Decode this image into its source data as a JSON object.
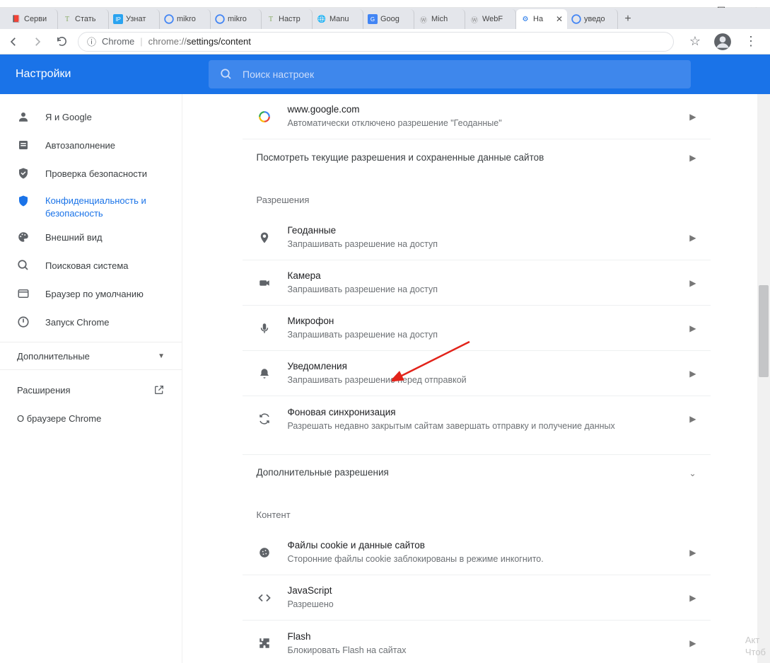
{
  "window": {
    "min": "—",
    "max": "☐",
    "close": "✕"
  },
  "tabs": [
    {
      "label": "Серви",
      "fav": "mail"
    },
    {
      "label": "Стать",
      "fav": "T"
    },
    {
      "label": "Узнат",
      "fav": "IP"
    },
    {
      "label": "mikro",
      "fav": "G"
    },
    {
      "label": "mikro",
      "fav": "G"
    },
    {
      "label": "Настр",
      "fav": "T"
    },
    {
      "label": "Manu",
      "fav": "globe"
    },
    {
      "label": "Goog",
      "fav": "Gt"
    },
    {
      "label": "Mich",
      "fav": "w"
    },
    {
      "label": "WebF",
      "fav": "w"
    },
    {
      "label": "На",
      "fav": "gear",
      "active": true
    },
    {
      "label": "уведо",
      "fav": "G"
    }
  ],
  "addr": {
    "chrome_label": "Chrome",
    "url_prefix": "chrome://",
    "url_path": "settings/content"
  },
  "header": {
    "title": "Настройки",
    "search_placeholder": "Поиск настроек"
  },
  "sidebar": {
    "items": [
      {
        "label": "Я и Google"
      },
      {
        "label": "Автозаполнение"
      },
      {
        "label": "Проверка безопасности"
      },
      {
        "label": "Конфиденциальность и\nбезопасность",
        "active": true
      },
      {
        "label": "Внешний вид"
      },
      {
        "label": "Поисковая система"
      },
      {
        "label": "Браузер по умолчанию"
      },
      {
        "label": "Запуск Chrome"
      }
    ],
    "advanced": "Дополнительные",
    "extensions": "Расширения",
    "about": "О браузере Chrome"
  },
  "content": {
    "site": {
      "title": "www.google.com",
      "sub": "Автоматически отключено разрешение \"Геоданные\""
    },
    "view_row": "Посмотреть текущие разрешения и сохраненные данные сайтов",
    "perm_header": "Разрешения",
    "perms": [
      {
        "title": "Геоданные",
        "sub": "Запрашивать разрешение на доступ"
      },
      {
        "title": "Камера",
        "sub": "Запрашивать разрешение на доступ"
      },
      {
        "title": "Микрофон",
        "sub": "Запрашивать разрешение на доступ"
      },
      {
        "title": "Уведомления",
        "sub": "Запрашивать разрешение перед отправкой"
      },
      {
        "title": "Фоновая синхронизация",
        "sub": "Разрешать недавно закрытым сайтам завершать отправку и получение данных"
      }
    ],
    "extra_perm": "Дополнительные разрешения",
    "content_header": "Контент",
    "contents": [
      {
        "title": "Файлы cookie и данные сайтов",
        "sub": "Сторонние файлы cookie заблокированы в режиме инкогнито."
      },
      {
        "title": "JavaScript",
        "sub": "Разрешено"
      },
      {
        "title": "Flash",
        "sub": "Блокировать Flash на сайтах"
      }
    ]
  },
  "watermark": {
    "l1": "Акт",
    "l2": "Чтоб"
  }
}
